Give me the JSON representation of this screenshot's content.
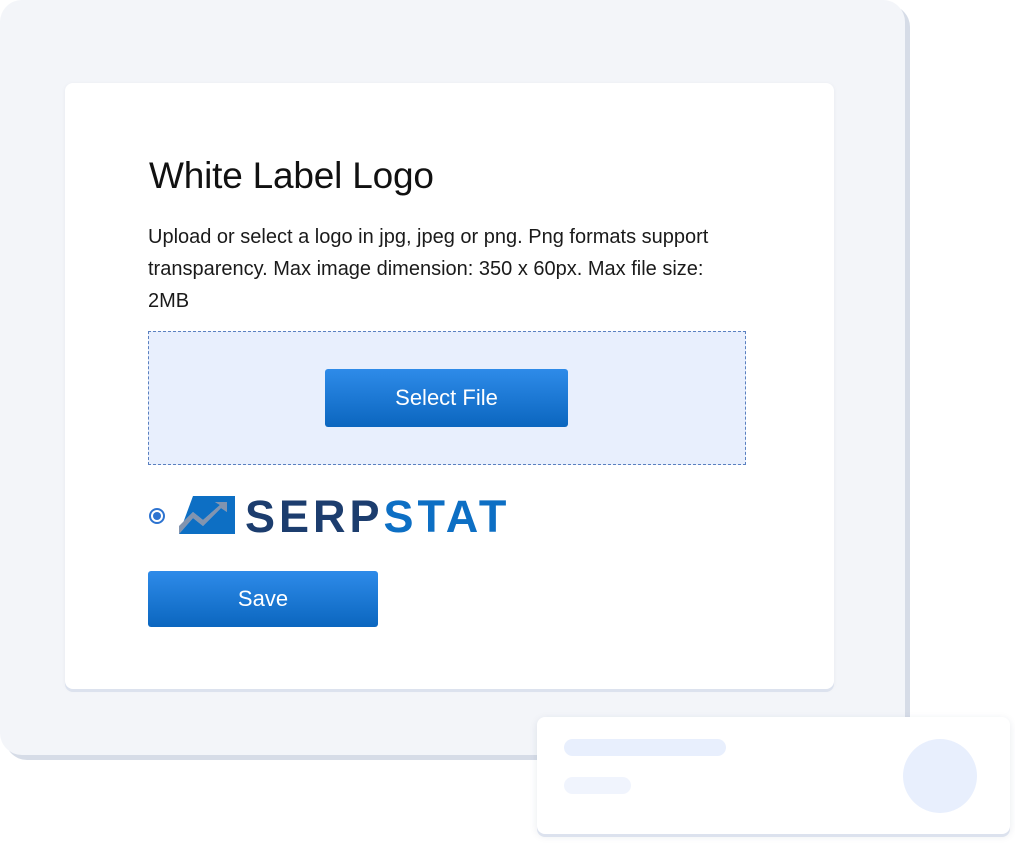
{
  "panel": {
    "title": "White Label Logo",
    "description": "Upload or select a logo in jpg, jpeg or png. Png formats support transparency. Max image dimension: 350 x 60px. Max file size: 2MB",
    "select_file_label": "Select File",
    "save_label": "Save"
  },
  "logo_option": {
    "selected": true,
    "brand_part_1": "SERP",
    "brand_part_2": "STAT",
    "icon": "serpstat-logo-mark-icon"
  },
  "colors": {
    "accent": "#1478d4",
    "brand_dark": "#1c3d6e",
    "brand_blue": "#0d6fc4",
    "dropzone_bg": "#e8effd",
    "backdrop": "#f3f5f9"
  }
}
